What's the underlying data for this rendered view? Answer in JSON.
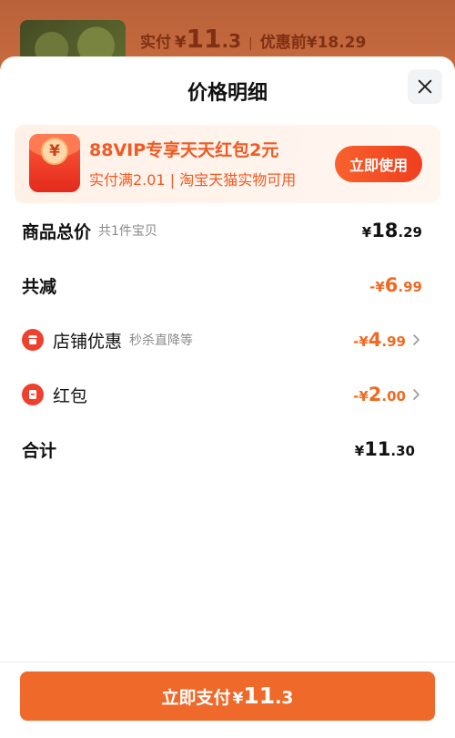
{
  "background_page": {
    "price_label": "实付",
    "currency": "¥",
    "price_int": "11",
    "price_dec": ".3",
    "separator": "|",
    "original_price": "优惠前¥18.29"
  },
  "sheet": {
    "title": "价格明细",
    "close_icon": "close-icon"
  },
  "promo": {
    "icon": "red-envelope-icon",
    "coin_symbol": "¥",
    "title": "88VIP专享天天红包2元",
    "subtitle": "实付满2.01 | 淘宝天猫实物可用",
    "button_label": "立即使用"
  },
  "rows": {
    "total": {
      "label": "商品总价",
      "sub": "共1件宝贝",
      "currency": "¥",
      "int": "18",
      "dec": ".29"
    },
    "reduction": {
      "label": "共减",
      "prefix": "-¥",
      "int": "6",
      "dec": ".99"
    },
    "shop_discount": {
      "icon": "shop-icon",
      "label": "店铺优惠",
      "sub": "秒杀直降等",
      "prefix": "-¥",
      "int": "4",
      "dec": ".99"
    },
    "red_packet": {
      "icon": "red-packet-icon",
      "label": "红包",
      "prefix": "-¥",
      "int": "2",
      "dec": ".00"
    },
    "sum": {
      "label": "合计",
      "currency": "¥",
      "int": "11",
      "dec": ".30"
    }
  },
  "footer": {
    "pay_label": "立即支付",
    "currency": "¥",
    "int": "11",
    "dec": ".3"
  },
  "colors": {
    "accent": "#ef6a2a",
    "promo_text": "#f05a23",
    "discount_text": "#f06a22"
  }
}
